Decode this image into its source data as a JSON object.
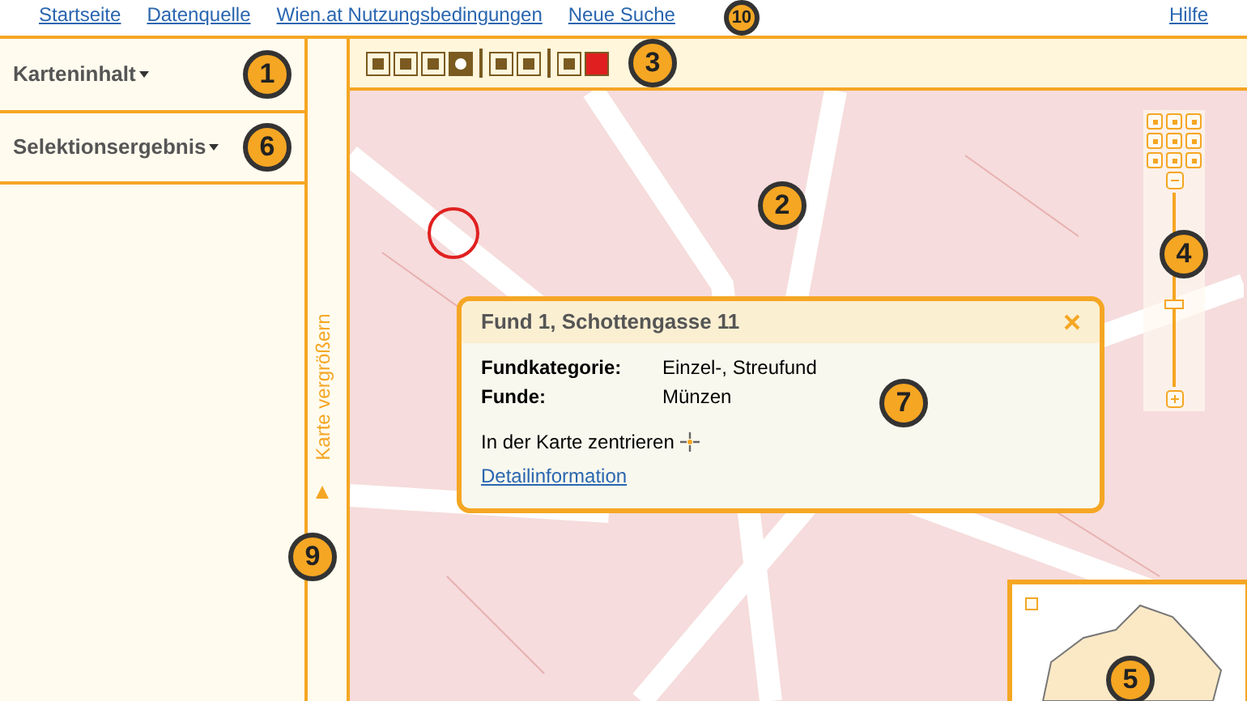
{
  "top_bar": {
    "links": [
      "Startseite",
      "Datenquelle",
      "Wien.at Nutzungsbedingungen",
      "Neue Suche"
    ],
    "badge": "10",
    "help": "Hilfe"
  },
  "left_panel": {
    "sections": [
      {
        "label": "Karteninhalt",
        "badge": "1"
      },
      {
        "label": "Selektionsergebnis",
        "badge": "6"
      }
    ]
  },
  "toggle_strip": {
    "label": "Karte vergrößern",
    "badge": "9"
  },
  "toolbar": {
    "badge": "3"
  },
  "map": {
    "badge": "2",
    "zoom_badge": "4",
    "zoom_slider": {
      "level": 0.42
    },
    "overview_badge": "5",
    "popup": {
      "title": "Fund 1, Schottengasse 11",
      "rows": [
        {
          "label": "Fundkategorie:",
          "value": "Einzel-, Streufund"
        },
        {
          "label": "Funde:",
          "value": "Münzen"
        }
      ],
      "center_text": "In der Karte zentrieren",
      "link": "Detailinformation",
      "badge": "7"
    }
  }
}
